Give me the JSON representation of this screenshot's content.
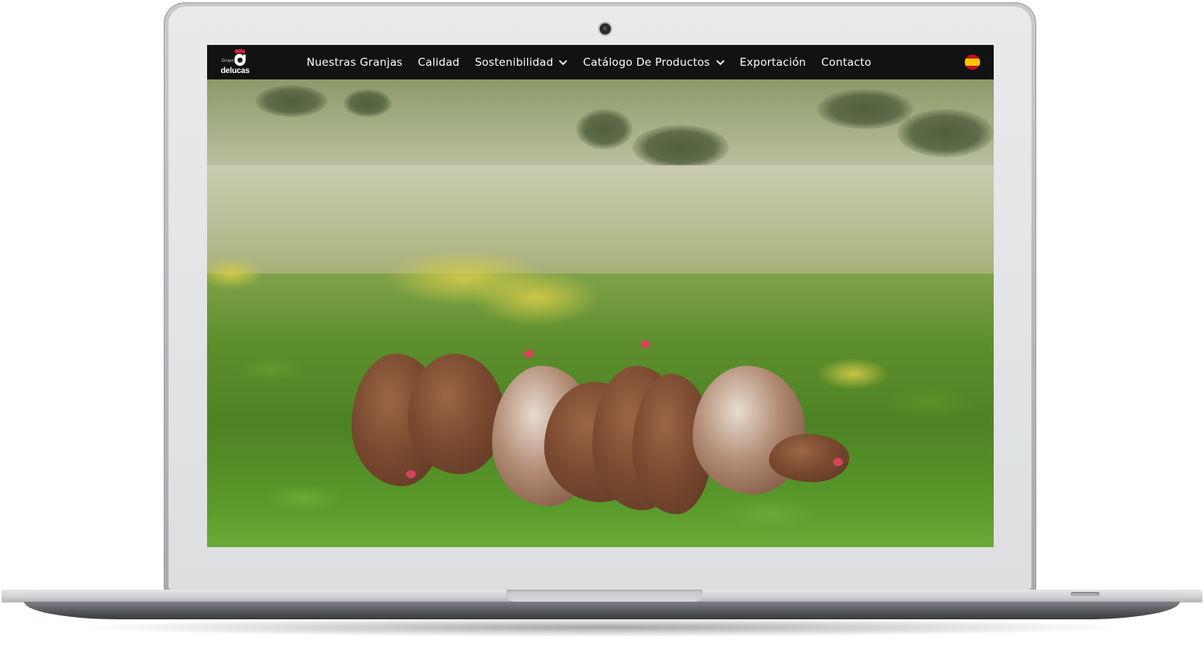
{
  "site": {
    "logo_small": "Grupo",
    "logo_word": "delucas"
  },
  "nav": {
    "items": [
      {
        "label": "Nuestras Granjas",
        "has_dropdown": false
      },
      {
        "label": "Calidad",
        "has_dropdown": false
      },
      {
        "label": "Sostenibilidad",
        "has_dropdown": true
      },
      {
        "label": "Catálogo De Productos",
        "has_dropdown": true
      },
      {
        "label": "Exportación",
        "has_dropdown": false
      },
      {
        "label": "Contacto",
        "has_dropdown": false
      }
    ],
    "language_flag": "spain-flag-icon"
  },
  "hero": {
    "image": "hens-in-field-photo"
  },
  "colors": {
    "nav_bg": "#121212",
    "nav_text": "#ffffff",
    "logo_accent": "#d6233a"
  }
}
